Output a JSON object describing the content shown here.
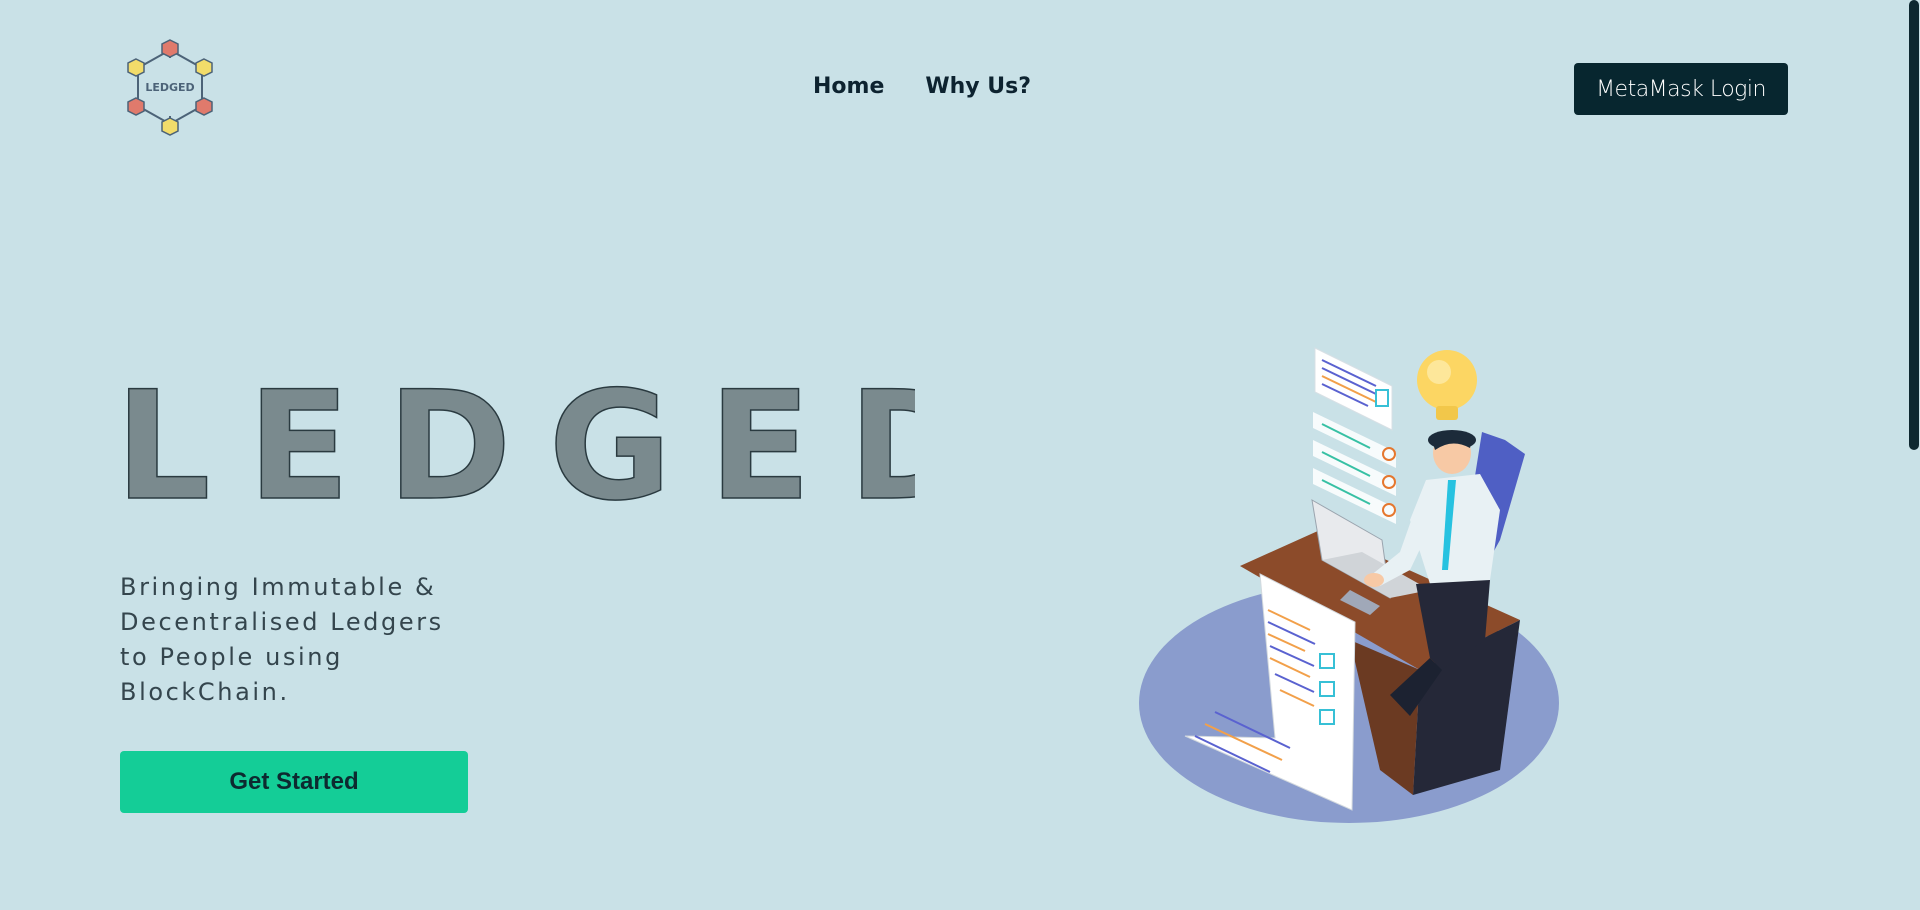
{
  "logo": {
    "text": "LEDGED",
    "icon": "blockchain-hexagon-icon"
  },
  "nav": {
    "items": [
      {
        "label": "Home"
      },
      {
        "label": "Why Us?"
      }
    ]
  },
  "header": {
    "login_label": "MetaMask Login"
  },
  "hero": {
    "title": "LEDGED",
    "tagline_lines": [
      "Bringing Immutable &",
      "Decentralised Ledgers",
      "to People using",
      "BlockChain."
    ],
    "cta_label": "Get Started"
  },
  "illustration": {
    "icon": "person-at-desk-illustration"
  },
  "colors": {
    "background": "#c9e1e7",
    "login_button": "#07262f",
    "cta_button": "#14cd97",
    "title_fill": "#7a8a8e",
    "circle": "#8a9ccd"
  }
}
